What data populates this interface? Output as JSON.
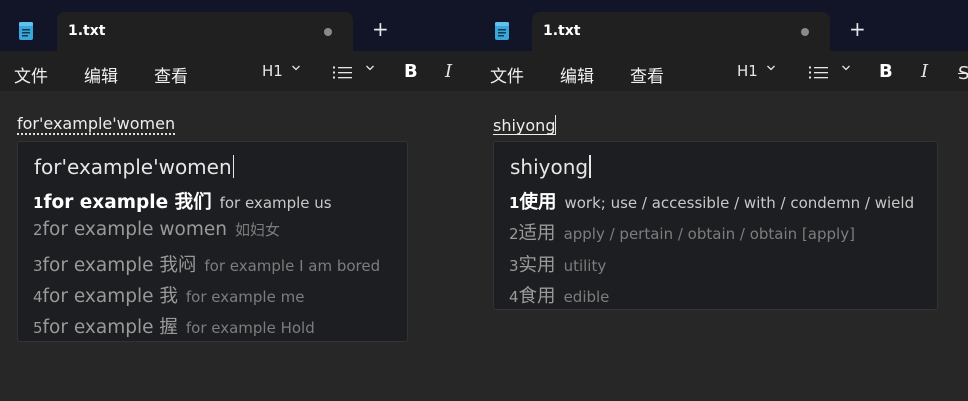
{
  "tab_title": "1.txt",
  "new_tab_symbol": "+",
  "menu": {
    "file": "文件",
    "edit": "编辑",
    "view": "查看"
  },
  "toolbar": {
    "heading": "H1",
    "bold": "B",
    "italic": "I",
    "strike": "S"
  },
  "left": {
    "editor_text": "for'example'women",
    "ime_input": "for'example'women",
    "candidates": [
      {
        "num": "1",
        "word": "for example 我们",
        "gloss": "for example us"
      },
      {
        "num": "2",
        "word": "for example women",
        "gloss": "如妇女"
      },
      {
        "num": "3",
        "word": "for example 我闷",
        "gloss": "for example I am bored"
      },
      {
        "num": "4",
        "word": "for example 我",
        "gloss": "for example me"
      },
      {
        "num": "5",
        "word": "for example 握",
        "gloss": "for example Hold"
      }
    ]
  },
  "right": {
    "editor_text": "shiyong",
    "ime_input": "shiyong",
    "candidates": [
      {
        "num": "1",
        "word": "使用",
        "gloss": "work; use / accessible / with / condemn / wield"
      },
      {
        "num": "2",
        "word": "适用",
        "gloss": "apply / pertain / obtain / obtain [apply]"
      },
      {
        "num": "3",
        "word": "实用",
        "gloss": "utility"
      },
      {
        "num": "4",
        "word": "食用",
        "gloss": "edible"
      }
    ]
  },
  "colors": {
    "titlebar": "#121528",
    "toolbar": "#202020",
    "editor": "#272727",
    "ime_popup": "#1d1e21"
  }
}
